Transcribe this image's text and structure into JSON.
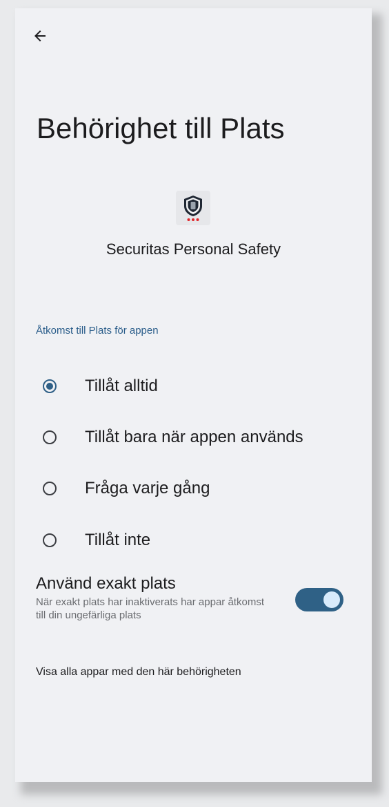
{
  "header": {
    "back_icon": "arrow-left-icon",
    "title": "Behörighet till Plats"
  },
  "app": {
    "icon": "shield-icon",
    "name": "Securitas Personal Safety"
  },
  "section": {
    "label": "Åtkomst till Plats för appen"
  },
  "options": [
    {
      "label": "Tillåt alltid",
      "selected": true
    },
    {
      "label": "Tillåt bara när appen används",
      "selected": false
    },
    {
      "label": "Fråga varje gång",
      "selected": false
    },
    {
      "label": "Tillåt inte",
      "selected": false
    }
  ],
  "precise": {
    "title": "Använd exakt plats",
    "description": "När exakt plats har inaktiverats har appar åtkomst till din ungefärliga plats",
    "enabled": true
  },
  "footer": {
    "link": "Visa alla appar med den här behörigheten"
  },
  "colors": {
    "accent": "#2e5f86",
    "background": "#f0f1f4",
    "section_label": "#2a5d8a"
  }
}
